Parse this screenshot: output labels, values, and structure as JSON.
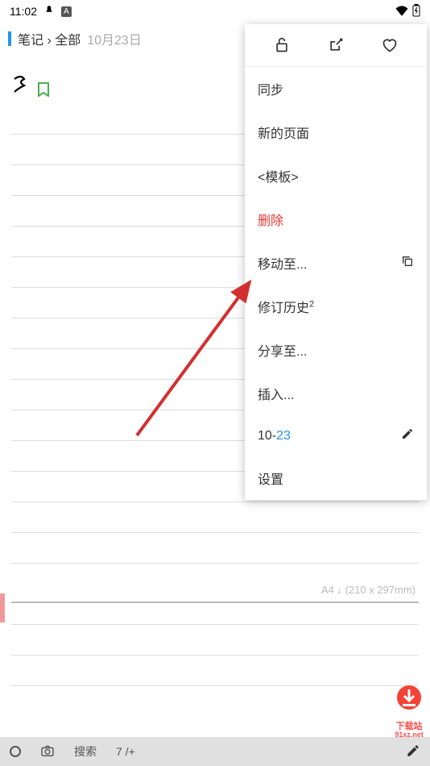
{
  "status": {
    "time": "11:02",
    "badge": "A"
  },
  "header": {
    "breadcrumb": "笔记 › 全部",
    "date": "10月23日"
  },
  "menu": {
    "sync": "同步",
    "new_page": "新的页面",
    "template": "<模板>",
    "delete": "删除",
    "move_to": "移动至...",
    "revision_history": "修订历史",
    "revision_sup": "2",
    "share_to": "分享至...",
    "insert": "插入...",
    "date_prefix": "10-",
    "date_suffix": "23",
    "settings": "设置"
  },
  "page_info": {
    "size_label": "A4 ↓ (210 x 297mm)"
  },
  "bottom": {
    "search": "搜索",
    "page_info": "7 /+"
  },
  "watermark": {
    "t1": "下载站",
    "t2": "91xz.net"
  }
}
